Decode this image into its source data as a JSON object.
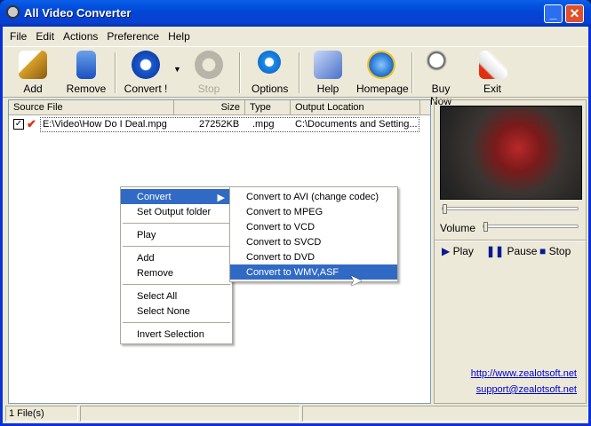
{
  "window": {
    "title": "All Video Converter"
  },
  "menu": [
    "File",
    "Edit",
    "Actions",
    "Preference",
    "Help"
  ],
  "toolbar": {
    "add": "Add",
    "remove": "Remove",
    "convert": "Convert !",
    "stop": "Stop",
    "options": "Options",
    "help": "Help",
    "homepage": "Homepage",
    "buy": "Buy Now",
    "exit": "Exit"
  },
  "list": {
    "headers": [
      "Source File",
      "Size",
      "Type",
      "Output Location"
    ],
    "rows": [
      {
        "source": "E:\\Video\\How Do I Deal.mpg",
        "size": "27252KB",
        "type": ".mpg",
        "output": "C:\\Documents and Setting..."
      }
    ]
  },
  "player": {
    "volume": "Volume",
    "play": "Play",
    "pause": "Pause",
    "stop": "Stop",
    "position": 0,
    "volume_level": 0
  },
  "links": {
    "site": "http://www.zealotsoft.net",
    "email": "support@zealotsoft.net"
  },
  "status": {
    "files": "1 File(s)"
  },
  "context_menu": [
    "Convert",
    "Set Output folder",
    "Play",
    "Add",
    "Remove",
    "Select All",
    "Select None",
    "Invert Selection"
  ],
  "submenu": [
    "Convert to AVI (change codec)",
    "Convert to MPEG",
    "Convert to VCD",
    "Convert to SVCD",
    "Convert to DVD",
    "Convert to WMV,ASF"
  ]
}
